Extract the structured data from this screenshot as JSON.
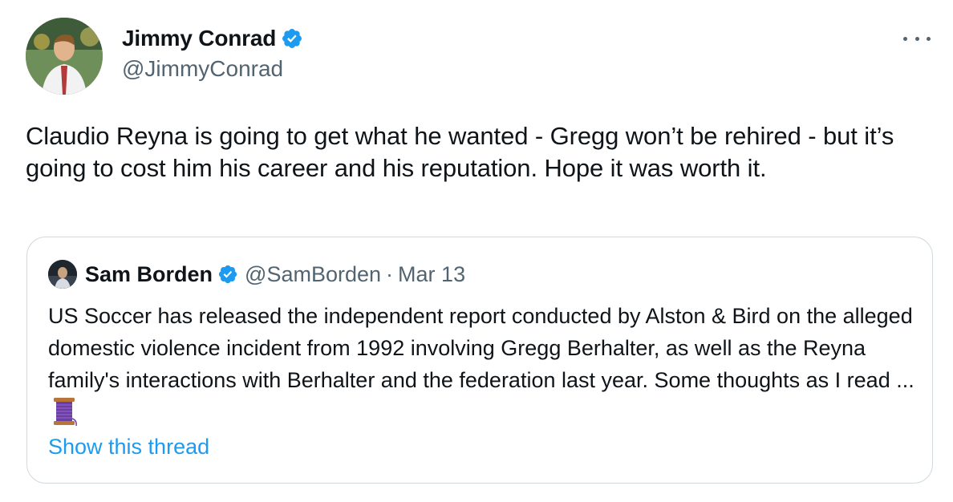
{
  "tweet": {
    "author": {
      "name": "Jimmy Conrad",
      "handle": "@JimmyConrad",
      "verified": true,
      "avatar_icon": "profile-photo"
    },
    "more_icon": "more-horizontal-icon",
    "text": "Claudio Reyna is going to get what he wanted - Gregg won’t be rehired - but it’s going to cost him his career and his reputation. Hope it was worth it."
  },
  "quoted_tweet": {
    "author": {
      "name": "Sam Borden",
      "handle": "@SamBorden",
      "verified": true,
      "avatar_icon": "profile-photo"
    },
    "separator": "·",
    "date": "Mar 13",
    "text": "US Soccer has released the independent report conducted by Alston & Bird on the alleged domestic violence incident from 1992 involving Gregg Berhalter, as well as the Reyna family's interactions with Berhalter and the federation last year. Some thoughts as I read ...",
    "emoji": "spool-of-thread",
    "show_thread_label": "Show this thread"
  },
  "colors": {
    "text": "#0f1419",
    "secondary": "#536471",
    "link": "#1d9bf0",
    "verified": "#1d9bf0",
    "border": "#cfd9de"
  }
}
